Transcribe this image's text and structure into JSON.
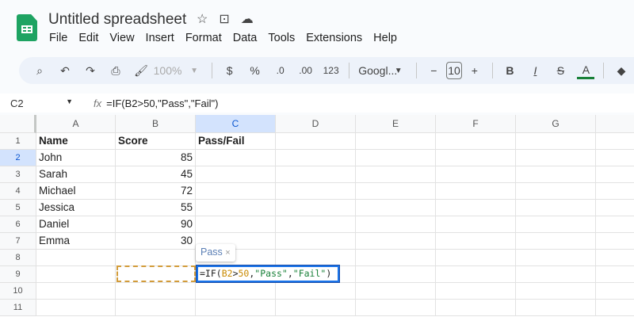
{
  "app": {
    "title": "Untitled spreadsheet",
    "menu": [
      "File",
      "Edit",
      "View",
      "Insert",
      "Format",
      "Data",
      "Tools",
      "Extensions",
      "Help"
    ]
  },
  "toolbar": {
    "zoom": "100%",
    "currency": "$",
    "percent": "%",
    "dec_decrease": ".0",
    "dec_increase": ".00",
    "number_format": "123",
    "font": "Googl...",
    "font_size": "10",
    "bold": "B",
    "italic": "I",
    "text_color": "A",
    "text_color_value": "#188038"
  },
  "formula_bar": {
    "cell_ref": "C2",
    "formula": "=IF(B2>50,\"Pass\",\"Fail\")"
  },
  "columns": [
    "A",
    "B",
    "C",
    "D",
    "E",
    "F",
    "G"
  ],
  "rows": [
    "1",
    "2",
    "3",
    "4",
    "5",
    "6",
    "7",
    "8",
    "9",
    "10",
    "11"
  ],
  "cells": {
    "A1": "Name",
    "B1": "Score",
    "C1": "Pass/Fail",
    "data": [
      [
        "John",
        "85"
      ],
      [
        "Sarah",
        "45"
      ],
      [
        "Michael",
        "72"
      ],
      [
        "Jessica",
        "55"
      ],
      [
        "Daniel",
        "90"
      ],
      [
        "Emma",
        "30"
      ]
    ]
  },
  "editor": {
    "p1": "=IF(",
    "p2": "B2",
    "p3": ">",
    "p4": "50",
    "p5": ",",
    "p6": "\"Pass\"",
    "p7": ",",
    "p8": "\"Fail\"",
    "p9": ")"
  },
  "tooltip": {
    "suggestion": "Pass",
    "close": "×"
  }
}
